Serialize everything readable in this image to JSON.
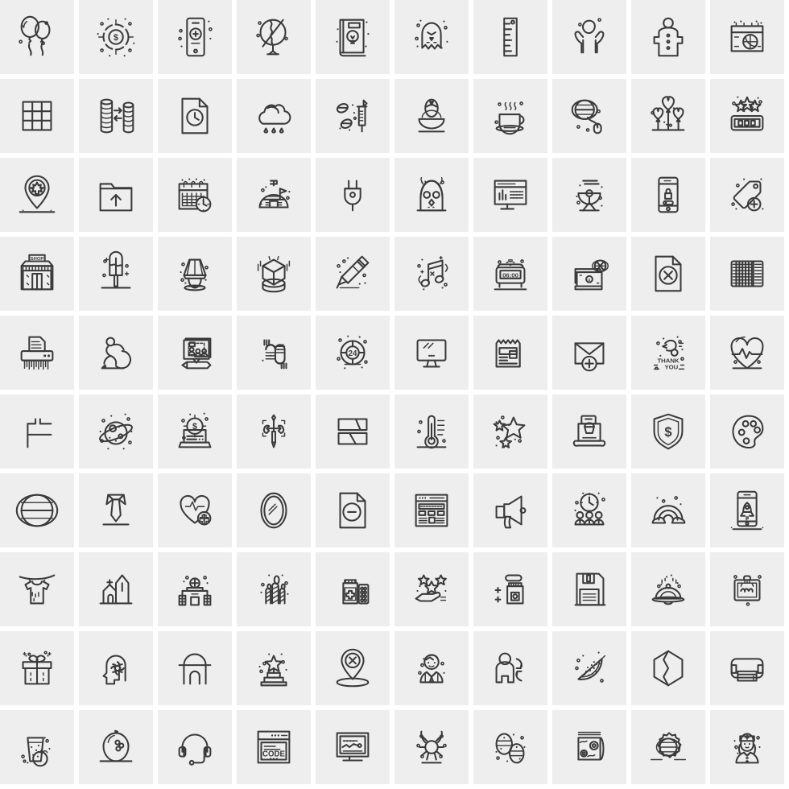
{
  "grid": {
    "columns": 10,
    "rows": 10,
    "total_icons": 100,
    "tile_background": "#eeeeee",
    "gap_background": "#ffffff",
    "stroke_color": "#3a3a3a",
    "style": "outline / line-art"
  },
  "text_in_icons": {
    "shop_sign": "SHOP",
    "lifebuoy_number": "24",
    "thank_you_line1": "THANK",
    "thank_you_line2": "YOU",
    "clock_display": "06:00",
    "code_window": "CODE",
    "dollar_sign": "$"
  },
  "icons": [
    {
      "row": 1,
      "col": 1,
      "name": "balloons-icon",
      "label": "Balloons"
    },
    {
      "row": 1,
      "col": 2,
      "name": "dollar-target-icon",
      "label": "Dollar Target"
    },
    {
      "row": 1,
      "col": 3,
      "name": "mobile-add-icon",
      "label": "Mobile Add"
    },
    {
      "row": 1,
      "col": 4,
      "name": "cracked-globe-icon",
      "label": "Cracked Globe"
    },
    {
      "row": 1,
      "col": 5,
      "name": "idea-book-icon",
      "label": "Idea Book"
    },
    {
      "row": 1,
      "col": 6,
      "name": "ghost-icon",
      "label": "Ghost"
    },
    {
      "row": 1,
      "col": 7,
      "name": "ruler-icon",
      "label": "Ruler"
    },
    {
      "row": 1,
      "col": 8,
      "name": "hands-moon-icon",
      "label": "Hands Moon"
    },
    {
      "row": 1,
      "col": 9,
      "name": "pajamas-icon",
      "label": "Pajamas"
    },
    {
      "row": 1,
      "col": 10,
      "name": "basketball-calendar-icon",
      "label": "Basketball Calendar"
    },
    {
      "row": 2,
      "col": 1,
      "name": "grid-window-icon",
      "label": "Window Grid"
    },
    {
      "row": 2,
      "col": 2,
      "name": "coins-transfer-icon",
      "label": "Coins Transfer"
    },
    {
      "row": 2,
      "col": 3,
      "name": "document-clock-icon",
      "label": "Document Clock"
    },
    {
      "row": 2,
      "col": 4,
      "name": "cloud-rain-icon",
      "label": "Rain Cloud"
    },
    {
      "row": 2,
      "col": 5,
      "name": "pills-syringe-icon",
      "label": "Pills Syringe"
    },
    {
      "row": 2,
      "col": 6,
      "name": "easter-egg-basket-icon",
      "label": "Egg Basket"
    },
    {
      "row": 2,
      "col": 7,
      "name": "hot-coffee-icon",
      "label": "Hot Coffee"
    },
    {
      "row": 2,
      "col": 8,
      "name": "globe-mouse-icon",
      "label": "Globe Mouse"
    },
    {
      "row": 2,
      "col": 9,
      "name": "heart-balloons-icon",
      "label": "Heart Balloons"
    },
    {
      "row": 2,
      "col": 10,
      "name": "star-rating-box-icon",
      "label": "Star Rating"
    },
    {
      "row": 3,
      "col": 1,
      "name": "canada-location-pin-icon",
      "label": "Maple Location Pin"
    },
    {
      "row": 3,
      "col": 2,
      "name": "folder-upload-icon",
      "label": "Folder Upload"
    },
    {
      "row": 3,
      "col": 3,
      "name": "calendar-clock-icon",
      "label": "Calendar Clock"
    },
    {
      "row": 3,
      "col": 4,
      "name": "igloo-flag-icon",
      "label": "Igloo Flag"
    },
    {
      "row": 3,
      "col": 5,
      "name": "power-plug-icon",
      "label": "Power Plug"
    },
    {
      "row": 3,
      "col": 6,
      "name": "owl-icon",
      "label": "Owl"
    },
    {
      "row": 3,
      "col": 7,
      "name": "monitor-analytics-icon",
      "label": "Monitor Analytics"
    },
    {
      "row": 3,
      "col": 8,
      "name": "satellite-dish-icon",
      "label": "Satellite Dish"
    },
    {
      "row": 3,
      "col": 9,
      "name": "mobile-lock-icon",
      "label": "Mobile Lock"
    },
    {
      "row": 3,
      "col": 10,
      "name": "tag-add-icon",
      "label": "Add Tag"
    },
    {
      "row": 4,
      "col": 1,
      "name": "shop-storefront-icon",
      "label": "Shop Storefront"
    },
    {
      "row": 4,
      "col": 2,
      "name": "ice-cream-bar-icon",
      "label": "Ice Cream Bar"
    },
    {
      "row": 4,
      "col": 3,
      "name": "table-lamp-icon",
      "label": "Table Lamp"
    },
    {
      "row": 4,
      "col": 4,
      "name": "3d-cube-pedestal-icon",
      "label": "3D Cube"
    },
    {
      "row": 4,
      "col": 5,
      "name": "highlighter-pen-icon",
      "label": "Highlighter"
    },
    {
      "row": 4,
      "col": 6,
      "name": "music-notes-icon",
      "label": "Music Notes"
    },
    {
      "row": 4,
      "col": 7,
      "name": "wireless-alarm-clock-icon",
      "label": "Wireless Alarm Clock"
    },
    {
      "row": 4,
      "col": 8,
      "name": "cash-global-icon",
      "label": "Cash Global"
    },
    {
      "row": 4,
      "col": 9,
      "name": "file-delete-icon",
      "label": "File Delete"
    },
    {
      "row": 4,
      "col": 10,
      "name": "accordion-icon",
      "label": "Accordion"
    },
    {
      "row": 5,
      "col": 1,
      "name": "paper-shredder-icon",
      "label": "Paper Shredder"
    },
    {
      "row": 5,
      "col": 2,
      "name": "slip-fall-icon",
      "label": "Slip And Fall"
    },
    {
      "row": 5,
      "col": 3,
      "name": "presentation-team-icon",
      "label": "Presentation Team"
    },
    {
      "row": 5,
      "col": 4,
      "name": "caterpillar-icon",
      "label": "Caterpillar"
    },
    {
      "row": 5,
      "col": 5,
      "name": "lifebuoy-24-icon",
      "label": "24 Hour Support"
    },
    {
      "row": 5,
      "col": 6,
      "name": "desktop-monitor-icon",
      "label": "Desktop Monitor"
    },
    {
      "row": 5,
      "col": 7,
      "name": "newspaper-icon",
      "label": "Newspaper"
    },
    {
      "row": 5,
      "col": 8,
      "name": "mail-add-icon",
      "label": "Add Mail"
    },
    {
      "row": 5,
      "col": 9,
      "name": "thank-you-icon",
      "label": "Thank You"
    },
    {
      "row": 5,
      "col": 10,
      "name": "heartbeat-heart-icon",
      "label": "Heartbeat Heart"
    },
    {
      "row": 6,
      "col": 1,
      "name": "flowchart-lines-icon",
      "label": "Flow Lines"
    },
    {
      "row": 6,
      "col": 2,
      "name": "planet-saturn-icon",
      "label": "Planet"
    },
    {
      "row": 6,
      "col": 3,
      "name": "laptop-dollar-icon",
      "label": "Laptop Money"
    },
    {
      "row": 6,
      "col": 4,
      "name": "screwdriver-wrench-icon",
      "label": "Tools Repair"
    },
    {
      "row": 6,
      "col": 5,
      "name": "two-panels-icon",
      "label": "Split Panels"
    },
    {
      "row": 6,
      "col": 6,
      "name": "thermometer-icon",
      "label": "Thermometer"
    },
    {
      "row": 6,
      "col": 7,
      "name": "shooting-stars-icon",
      "label": "Stars"
    },
    {
      "row": 6,
      "col": 8,
      "name": "online-shopping-bag-icon",
      "label": "Shopping Bag"
    },
    {
      "row": 6,
      "col": 9,
      "name": "dollar-shield-icon",
      "label": "Money Shield"
    },
    {
      "row": 6,
      "col": 10,
      "name": "paint-palette-icon",
      "label": "Paint Palette"
    },
    {
      "row": 7,
      "col": 1,
      "name": "globe-grid-icon",
      "label": "Globe"
    },
    {
      "row": 7,
      "col": 2,
      "name": "necktie-icon",
      "label": "Necktie"
    },
    {
      "row": 7,
      "col": 3,
      "name": "heart-medical-add-icon",
      "label": "Heart Medical"
    },
    {
      "row": 7,
      "col": 4,
      "name": "oval-mirror-icon",
      "label": "Mirror"
    },
    {
      "row": 7,
      "col": 5,
      "name": "file-minus-icon",
      "label": "Remove File"
    },
    {
      "row": 7,
      "col": 6,
      "name": "web-layout-icon",
      "label": "Web Layout"
    },
    {
      "row": 7,
      "col": 7,
      "name": "megaphone-icon",
      "label": "Megaphone"
    },
    {
      "row": 7,
      "col": 8,
      "name": "team-schedule-icon",
      "label": "Team Schedule"
    },
    {
      "row": 7,
      "col": 9,
      "name": "rainbow-clouds-icon",
      "label": "Rainbow"
    },
    {
      "row": 7,
      "col": 10,
      "name": "mobile-rocket-icon",
      "label": "App Launch"
    },
    {
      "row": 8,
      "col": 1,
      "name": "drying-tshirt-icon",
      "label": "Drying Shirt"
    },
    {
      "row": 8,
      "col": 2,
      "name": "church-icon",
      "label": "Church"
    },
    {
      "row": 8,
      "col": 3,
      "name": "hospital-building-icon",
      "label": "Hospital"
    },
    {
      "row": 8,
      "col": 4,
      "name": "birthday-candles-icon",
      "label": "Candles"
    },
    {
      "row": 8,
      "col": 5,
      "name": "medicine-bottle-icon",
      "label": "Medicine"
    },
    {
      "row": 8,
      "col": 6,
      "name": "hand-stars-icon",
      "label": "Rating Hand"
    },
    {
      "row": 8,
      "col": 7,
      "name": "supplement-jar-icon",
      "label": "Supplements"
    },
    {
      "row": 8,
      "col": 8,
      "name": "floppy-disk-icon",
      "label": "Save Disk"
    },
    {
      "row": 8,
      "col": 9,
      "name": "food-cloche-icon",
      "label": "Food Cover"
    },
    {
      "row": 8,
      "col": 10,
      "name": "barber-kit-icon",
      "label": "Barber Kit"
    },
    {
      "row": 9,
      "col": 1,
      "name": "gift-box-icon",
      "label": "Gift Box"
    },
    {
      "row": 9,
      "col": 2,
      "name": "mind-flower-icon",
      "label": "Mindfulness"
    },
    {
      "row": 9,
      "col": 3,
      "name": "arch-door-icon",
      "label": "Arch Door"
    },
    {
      "row": 9,
      "col": 4,
      "name": "trophy-star-icon",
      "label": "Trophy"
    },
    {
      "row": 9,
      "col": 5,
      "name": "location-remove-icon",
      "label": "Remove Location"
    },
    {
      "row": 9,
      "col": 6,
      "name": "businessman-avatar-icon",
      "label": "Businessman"
    },
    {
      "row": 9,
      "col": 7,
      "name": "person-refresh-icon",
      "label": "Person Refresh"
    },
    {
      "row": 9,
      "col": 8,
      "name": "watermelon-slice-icon",
      "label": "Watermelon"
    },
    {
      "row": 9,
      "col": 9,
      "name": "hexagon-arrow-icon",
      "label": "Hexagon"
    },
    {
      "row": 9,
      "col": 10,
      "name": "printer-icon",
      "label": "Printer"
    },
    {
      "row": 10,
      "col": 1,
      "name": "juice-glass-icon",
      "label": "Fruit Juice"
    },
    {
      "row": 10,
      "col": 2,
      "name": "lemon-icon",
      "label": "Lemon"
    },
    {
      "row": 10,
      "col": 3,
      "name": "headset-icon",
      "label": "Headset"
    },
    {
      "row": 10,
      "col": 4,
      "name": "code-window-icon",
      "label": "Code Window"
    },
    {
      "row": 10,
      "col": 5,
      "name": "monitor-graph-icon",
      "label": "Monitor Graph"
    },
    {
      "row": 10,
      "col": 6,
      "name": "tick-bug-icon",
      "label": "Bug"
    },
    {
      "row": 10,
      "col": 7,
      "name": "easter-eggs-icon",
      "label": "Easter Eggs"
    },
    {
      "row": 10,
      "col": 8,
      "name": "map-roll-icon",
      "label": "Map Roll"
    },
    {
      "row": 10,
      "col": 9,
      "name": "global-settings-icon",
      "label": "Global Settings"
    },
    {
      "row": 10,
      "col": 10,
      "name": "nurse-avatar-icon",
      "label": "Nurse"
    }
  ]
}
